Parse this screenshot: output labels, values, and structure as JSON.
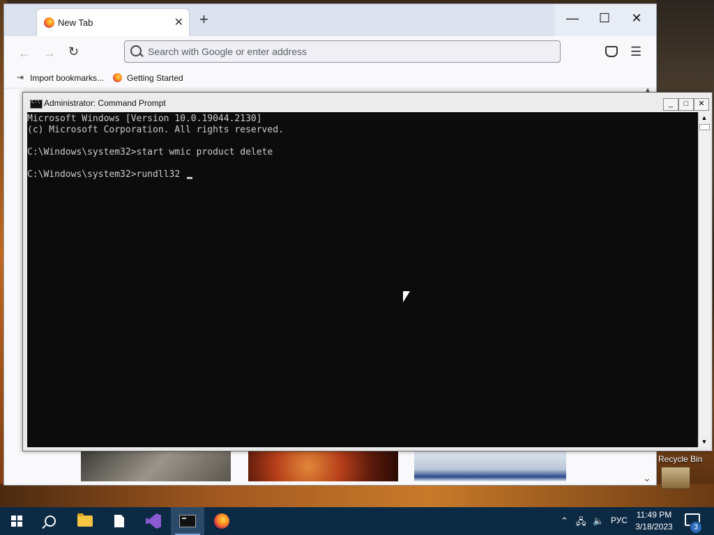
{
  "browser": {
    "tab_title": "New Tab",
    "new_tab_symbol": "+",
    "url_placeholder": "Search with Google or enter address",
    "bookmarks": [
      {
        "label": "Import bookmarks..."
      },
      {
        "label": "Getting Started"
      }
    ],
    "window_controls": {
      "minimize": "—",
      "maximize": "☐",
      "close": "✕"
    }
  },
  "cmd": {
    "title": "Administrator: Command Prompt",
    "lines": [
      "Microsoft Windows [Version 10.0.19044.2130]",
      "(c) Microsoft Corporation. All rights reserved.",
      "",
      "C:\\Windows\\system32>start wmic product delete",
      "",
      "C:\\Windows\\system32>rundll32 "
    ]
  },
  "desktop": {
    "recycle_bin_label": "Recycle Bin"
  },
  "taskbar": {
    "language": "РУС",
    "time": "11:49 PM",
    "date": "3/18/2023",
    "notification_count": "3"
  },
  "colors": {
    "console_bg": "#0c0c0c",
    "console_text": "#cccccc",
    "taskbar_bg": "#0d2a44"
  }
}
